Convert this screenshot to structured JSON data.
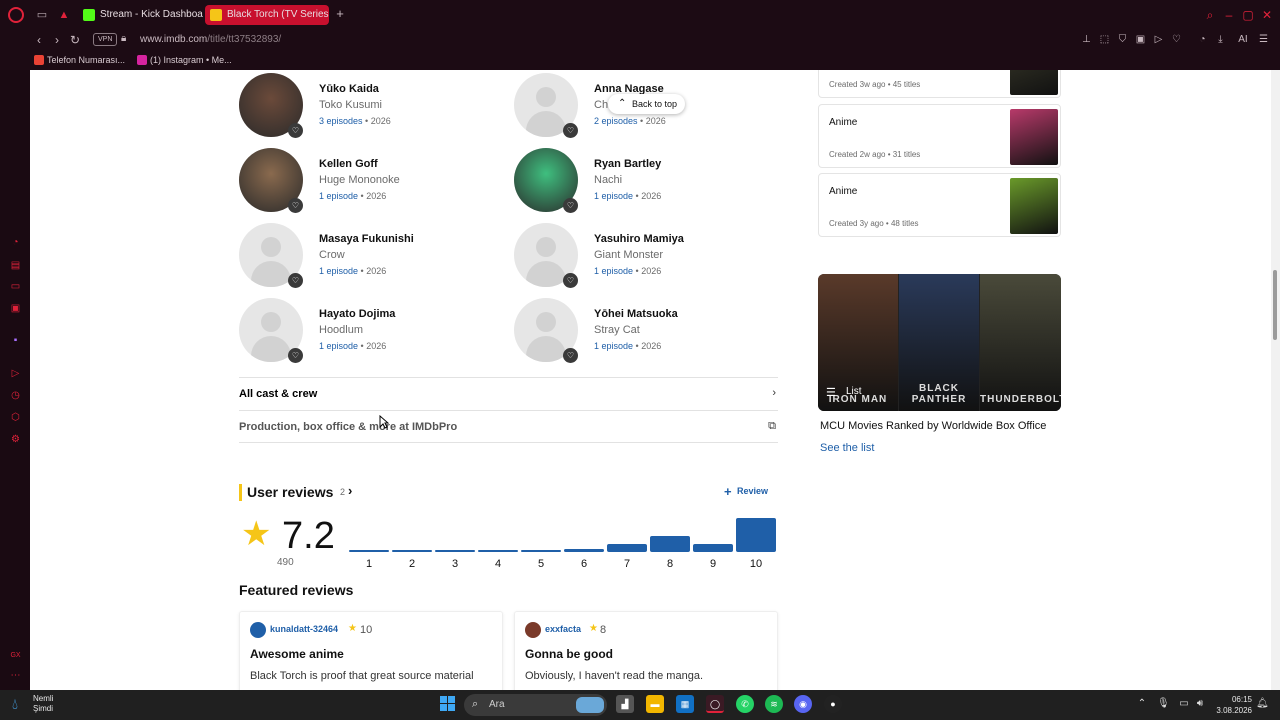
{
  "browser": {
    "tabs": [
      {
        "label": "Stream - Kick Dashboard",
        "active": false,
        "favicon_color": "#53fc18"
      },
      {
        "label": "Black Torch (TV Series 202",
        "active": true,
        "favicon_color": "#f5c518"
      }
    ],
    "vpn_label": "VPN",
    "url_host": "www.imdb.com",
    "url_path": "/title/tt37532893/",
    "bookmarks": [
      {
        "label": "Telefon Numarası...",
        "icon_color": "#ea4335"
      },
      {
        "label": "(1) Instagram • Me...",
        "icon_color": "#d6249f"
      }
    ],
    "ai_label": "AI"
  },
  "cast": [
    {
      "name": "Yūko Kaida",
      "role": "Toko Kusumi",
      "episodes": "3 episodes",
      "year": "2026",
      "photo": true,
      "photo_color": "#6b4a3a"
    },
    {
      "name": "Anna Nagase",
      "role": "Ch",
      "episodes": "2 episodes",
      "year": "2026",
      "photo": false
    },
    {
      "name": "Kellen Goff",
      "role": "Huge Mononoke",
      "episodes": "1 episode",
      "year": "2026",
      "photo": true,
      "photo_color": "#8a6a4e"
    },
    {
      "name": "Ryan Bartley",
      "role": "Nachi",
      "episodes": "1 episode",
      "year": "2026",
      "photo": true,
      "photo_color": "#3fbf7f"
    },
    {
      "name": "Masaya Fukunishi",
      "role": "Crow",
      "episodes": "1 episode",
      "year": "2026",
      "photo": false
    },
    {
      "name": "Yasuhiro Mamiya",
      "role": "Giant Monster",
      "episodes": "1 episode",
      "year": "2026",
      "photo": false
    },
    {
      "name": "Hayato Dojima",
      "role": "Hoodlum",
      "episodes": "1 episode",
      "year": "2026",
      "photo": false
    },
    {
      "name": "Yōhei Matsuoka",
      "role": "Stray Cat",
      "episodes": "1 episode",
      "year": "2026",
      "photo": false
    }
  ],
  "back_to_top": "Back to top",
  "all_cast": "All cast & crew",
  "production": "Production, box office & more at IMDbPro",
  "user_reviews": {
    "title": "User reviews",
    "count": "2",
    "review_button": "Review",
    "rating": "7.2",
    "votes": "490",
    "histogram": [
      {
        "label": "1",
        "value": 0.06
      },
      {
        "label": "2",
        "value": 0.03
      },
      {
        "label": "3",
        "value": 0.02
      },
      {
        "label": "4",
        "value": 0.03
      },
      {
        "label": "5",
        "value": 0.04
      },
      {
        "label": "6",
        "value": 0.1
      },
      {
        "label": "7",
        "value": 0.24
      },
      {
        "label": "8",
        "value": 0.48
      },
      {
        "label": "9",
        "value": 0.24
      },
      {
        "label": "10",
        "value": 1.0
      }
    ]
  },
  "featured_reviews": {
    "title": "Featured reviews",
    "items": [
      {
        "user": "kunaldatt-32464",
        "score": "10",
        "headline": "Awesome anime",
        "body": "Black Torch is proof that great source material",
        "avatar_color": "#1f5fa8"
      },
      {
        "user": "exxfacta",
        "score": "8",
        "headline": "Gonna be good",
        "body": "Obviously, I haven't read the manga.",
        "avatar_color": "#7a3a2a"
      }
    ]
  },
  "lists": [
    {
      "title": "",
      "meta": "Created 3w ago • 45 titles",
      "thumb_color": "#3a3a2a"
    },
    {
      "title": "Anime",
      "meta": "Created 2w ago • 31 titles",
      "thumb_color": "#b83a6a"
    },
    {
      "title": "Anime",
      "meta": "Created 3y ago • 48 titles",
      "thumb_color": "#6a9a2a"
    }
  ],
  "mcu": {
    "badge": "List",
    "title": "MCU Movies Ranked by Worldwide Box Office",
    "see_list": "See the list",
    "posters": [
      {
        "title": "IRON MAN",
        "color": "#5a3a2a"
      },
      {
        "title": "BLACK PANTHER",
        "color": "#2a3a5a"
      },
      {
        "title": "THUNDERBOLTS",
        "color": "#4a4a3a"
      }
    ]
  },
  "taskbar": {
    "weather_line1": "Nemli",
    "weather_line2": "Şimdi",
    "search_placeholder": "Ara",
    "time": "06:15",
    "date": "3.08.2026"
  }
}
